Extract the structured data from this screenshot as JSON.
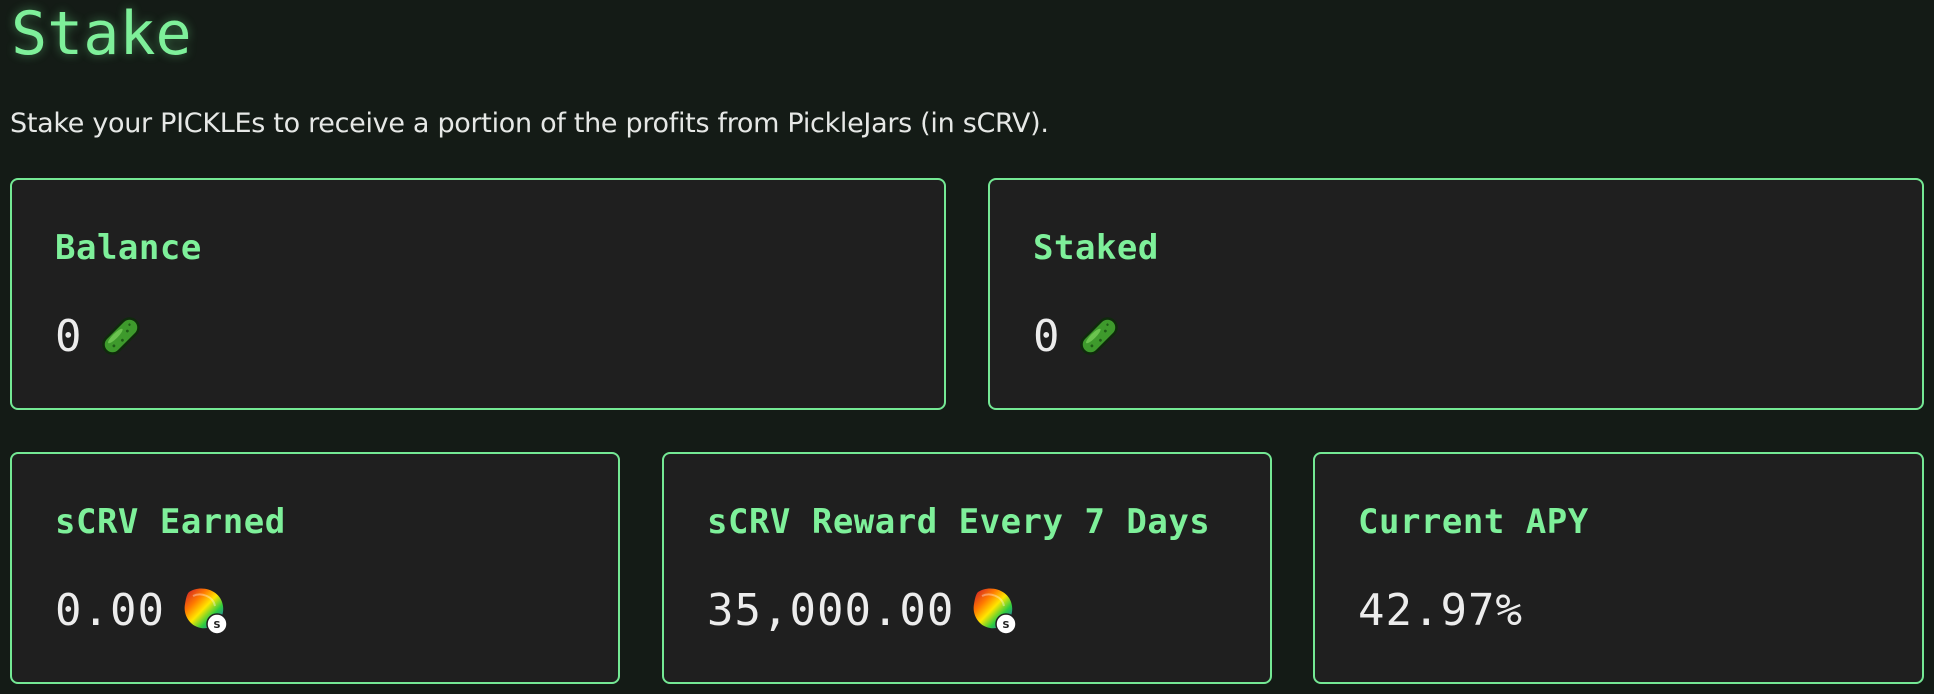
{
  "page": {
    "title": "Stake",
    "subtitle": "Stake your PICKLEs to receive a portion of the profits from PickleJars (in sCRV)."
  },
  "cards": {
    "balance": {
      "label": "Balance",
      "value": "0",
      "icon": "pickle-icon"
    },
    "staked": {
      "label": "Staked",
      "value": "0",
      "icon": "pickle-icon"
    },
    "earned": {
      "label": "sCRV Earned",
      "value": "0.00",
      "icon": "scrv-token-icon"
    },
    "reward": {
      "label": "sCRV Reward Every 7 Days",
      "value": "35,000.00",
      "icon": "scrv-token-icon"
    },
    "apy": {
      "label": "Current APY",
      "value": "42.97%"
    }
  },
  "colors": {
    "background": "#141b16",
    "accent": "#7ef09a",
    "card_background": "#1f1f1f",
    "card_border": "#74e894",
    "value_text": "#ececec"
  }
}
